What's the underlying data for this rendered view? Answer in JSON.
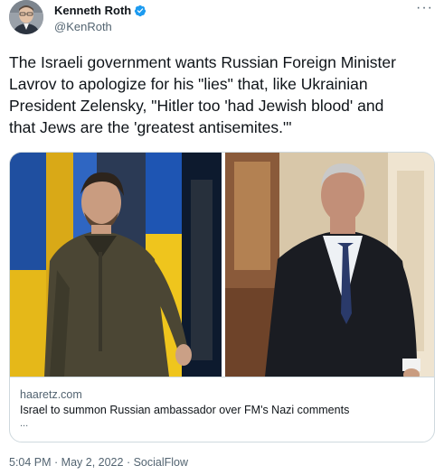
{
  "author": {
    "display_name": "Kenneth Roth",
    "handle": "@KenRoth",
    "verified": true,
    "more_label": "···"
  },
  "tweet": {
    "text": "The Israeli government wants Russian Foreign Minister\nLavrov to apologize for his \"lies\" that, like Ukrainian\nPresident Zelensky, \"Hitler too 'had Jewish blood' and\nthat Jews are the 'greatest antisemites.'\""
  },
  "link_card": {
    "domain": "haaretz.com",
    "title": "Israel to summon Russian ambassador over FM's Nazi comments",
    "description": "..."
  },
  "meta": {
    "time": "5:04 PM",
    "separator": " · ",
    "date": "May 2, 2022",
    "source": "SocialFlow"
  },
  "colors": {
    "verified": "#1d9bf0",
    "secondary_text": "#536471",
    "border": "#cfd9de"
  }
}
